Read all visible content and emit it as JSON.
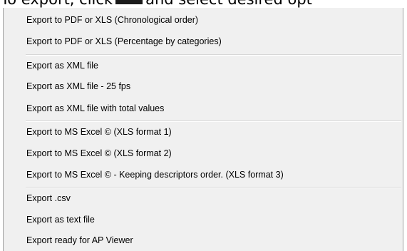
{
  "instruction": {
    "prefix": "To export, click",
    "suffix": "and select desired opt"
  },
  "menu": {
    "groups": [
      {
        "items": [
          "Export to PDF or XLS (Chronological order)",
          "Export to PDF or XLS (Percentage by categories)"
        ]
      },
      {
        "items": [
          "Export as XML file",
          "Export as XML file - 25 fps",
          "Export as XML file with total values"
        ]
      },
      {
        "items": [
          "Export to MS Excel © (XLS format 1)",
          "Export to MS Excel © (XLS format 2)",
          "Export to MS Excel © - Keeping descriptors order. (XLS format 3)"
        ]
      },
      {
        "items": [
          "Export .csv",
          "Export as text file",
          "Export ready for AP Viewer"
        ]
      }
    ]
  }
}
